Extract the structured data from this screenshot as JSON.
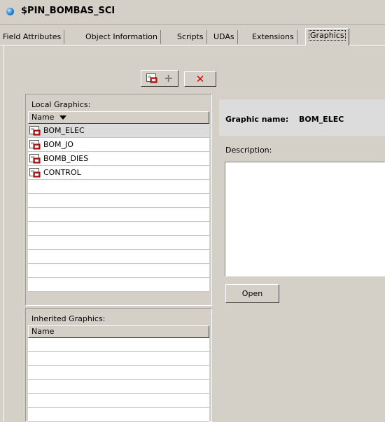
{
  "window": {
    "title": "$PIN_BOMBAS_SCI"
  },
  "tabs": [
    {
      "label": "Field Attributes"
    },
    {
      "label": "Object Information"
    },
    {
      "label": "Scripts"
    },
    {
      "label": "UDAs"
    },
    {
      "label": "Extensions"
    },
    {
      "label": "Graphics",
      "active": true
    }
  ],
  "toolbar": {
    "add_icon": "add-graphic-icon",
    "delete_icon": "delete-x-icon"
  },
  "local_graphics": {
    "label": "Local Graphics:",
    "column": "Name",
    "items": [
      "BOM_ELEC",
      "BOM_JO",
      "BOMB_DIES",
      "CONTROL"
    ],
    "selected": "BOM_ELEC"
  },
  "inherited_graphics": {
    "label": "Inherited Graphics:",
    "column": "Name",
    "items": []
  },
  "detail": {
    "graphic_name_label": "Graphic name:",
    "graphic_name_value": "BOM_ELEC",
    "description_label": "Description:",
    "description_value": "",
    "open_label": "Open"
  },
  "colors": {
    "window_bg": "#d4d0c8",
    "delete_red": "#e00000",
    "selected_row": "#dcdcdc"
  }
}
